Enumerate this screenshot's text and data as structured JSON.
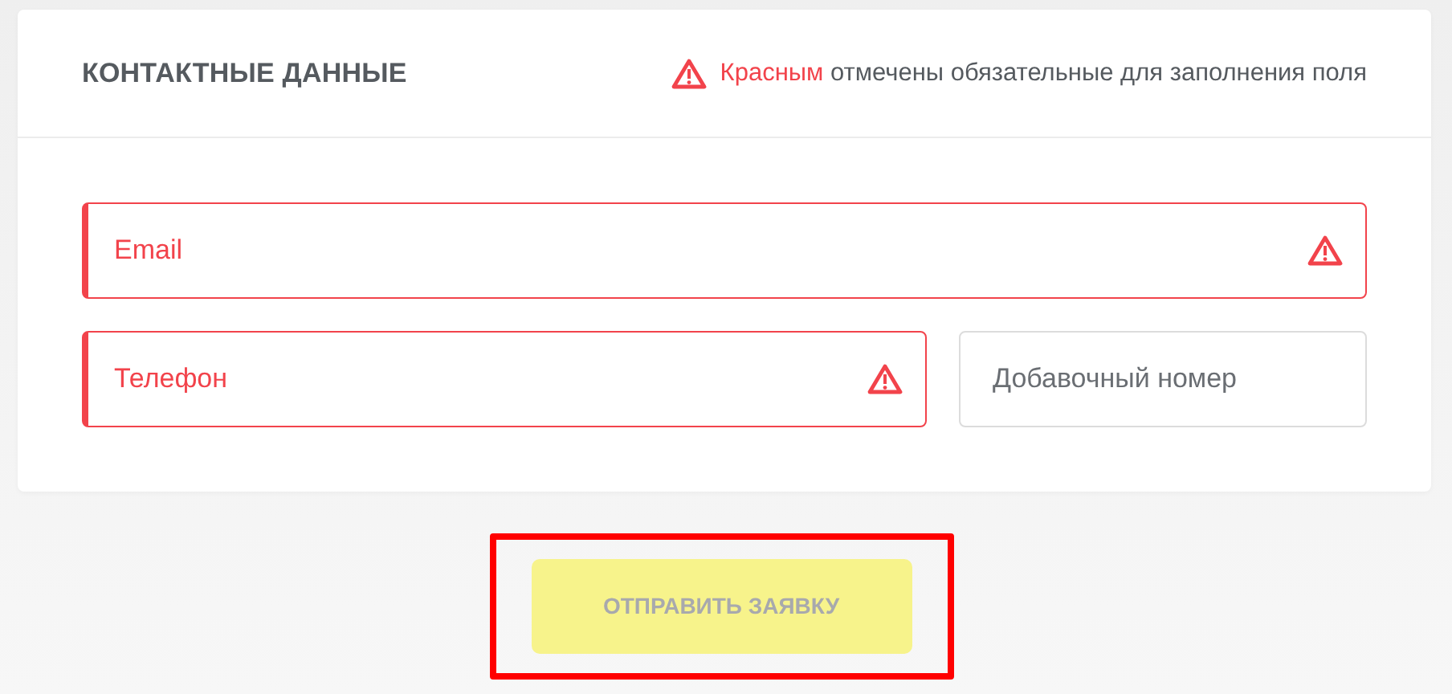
{
  "section": {
    "title": "КОНТАКТНЫЕ ДАННЫЕ",
    "notice": {
      "accent": "Красным",
      "text": "отмечены обязательные для заполнения поля"
    }
  },
  "field_rows": [
    [
      {
        "placeholder": "Email",
        "required": true
      }
    ],
    [
      {
        "placeholder": "Телефон",
        "required": true
      },
      {
        "placeholder": "Добавочный номер",
        "required": false
      }
    ]
  ],
  "submit": {
    "label": "ОТПРАВИТЬ ЗАЯВКУ",
    "disabled": true,
    "highlighted": true
  }
}
